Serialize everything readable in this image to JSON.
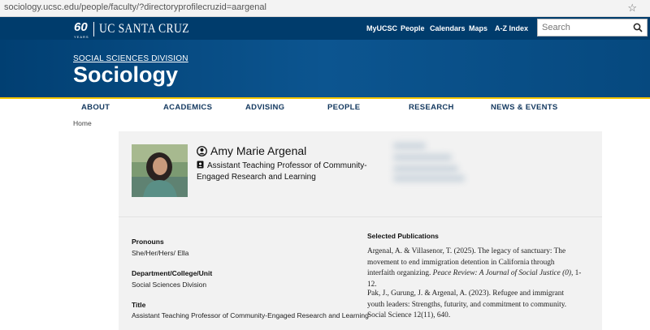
{
  "browser": {
    "url": "sociology.ucsc.edu/people/faculty/?directoryprofilecruzid=aargenal"
  },
  "header": {
    "logo_number": "60",
    "logo_years": "YEARS",
    "logo_text": "UC SANTA CRUZ",
    "links": [
      "MyUCSC",
      "People",
      "Calendars",
      "Maps",
      "A-Z Index"
    ],
    "search_placeholder": "Search",
    "search_icon": "magnifier-icon"
  },
  "banner": {
    "division": "SOCIAL SCIENCES DIVISION",
    "department": "Sociology"
  },
  "nav": {
    "items": [
      "ABOUT",
      "ACADEMICS",
      "ADVISING",
      "PEOPLE",
      "RESEARCH",
      "NEWS & EVENTS"
    ]
  },
  "breadcrumb": "Home",
  "profile": {
    "name": "Amy Marie Argenal",
    "title": "Assistant Teaching Professor of Community-Engaged Research and Learning",
    "fields": [
      {
        "label": "Pronouns",
        "value": "She/Her/Hers/ Ella"
      },
      {
        "label": "Department/College/Unit",
        "value": "Social Sciences Division"
      },
      {
        "label": "Title",
        "value": "Assistant Teaching Professor of Community-Engaged Research and Learning"
      }
    ]
  },
  "publications": {
    "heading": "Selected Publications",
    "items": [
      {
        "before": "Argenal, A. & Villasenor, T. (2025).  The legacy of sanctuary: The movement to end immigration detention in California through interfaith organizing.  ",
        "journal": "Peace Review: A Journal of Social Justice (0)",
        "after": ", 1-12."
      },
      {
        "before": "Pak, J., Gurung, J. & Argenal, A.  (2023).  Refugee and immigrant youth leaders: Strengths, futurity, and commitment to community.  Social Science 12(11), 640.",
        "journal": "",
        "after": ""
      }
    ]
  },
  "colors": {
    "navy": "#003c6c",
    "gold": "#fdc700",
    "card": "#f2f2f2"
  }
}
